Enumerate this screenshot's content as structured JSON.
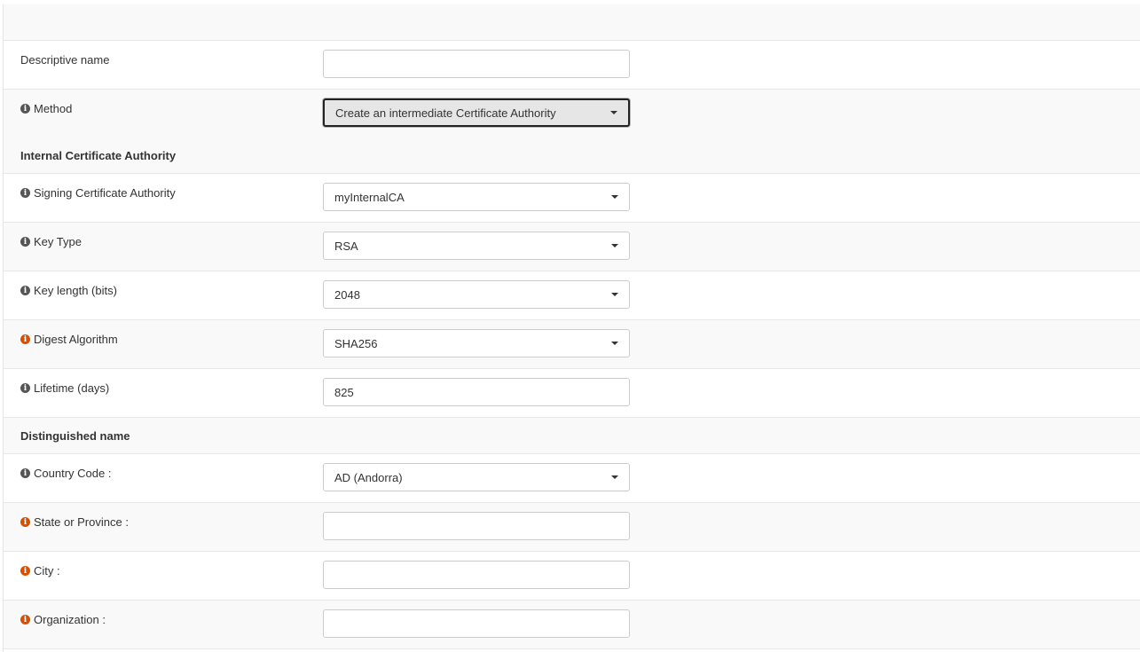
{
  "fields": {
    "descriptive_name": {
      "label": "Descriptive name",
      "value": ""
    },
    "method": {
      "label": "Method",
      "value": "Create an intermediate Certificate Authority"
    },
    "section_internal": "Internal Certificate Authority",
    "signing_ca": {
      "label": "Signing Certificate Authority",
      "value": "myInternalCA"
    },
    "key_type": {
      "label": "Key Type",
      "value": "RSA"
    },
    "key_length": {
      "label": "Key length (bits)",
      "value": "2048"
    },
    "digest": {
      "label": "Digest Algorithm",
      "value": "SHA256"
    },
    "lifetime": {
      "label": "Lifetime (days)",
      "value": "825"
    },
    "section_dn": "Distinguished name",
    "country": {
      "label": "Country Code :",
      "value": "AD (Andorra)"
    },
    "state": {
      "label": "State or Province :",
      "value": ""
    },
    "city": {
      "label": "City :",
      "value": ""
    },
    "organization": {
      "label": "Organization :",
      "value": ""
    }
  },
  "icons": {
    "info": "info-circle-icon",
    "info_color": "#555555",
    "warn_color": "#d94f00"
  }
}
